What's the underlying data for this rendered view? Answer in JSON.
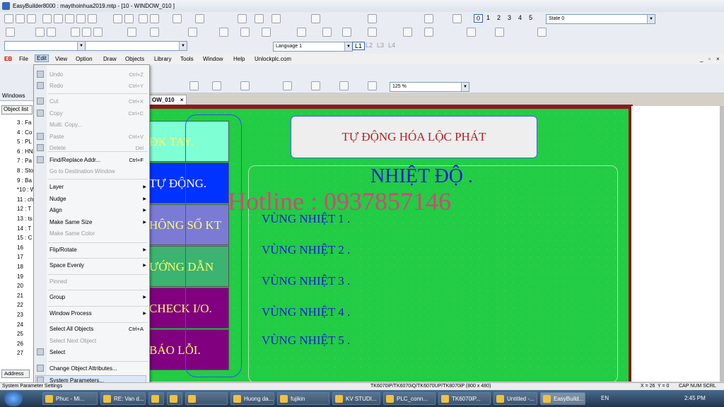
{
  "window": {
    "title": "EasyBuilder8000 : maythoinhua2019.mtp - [10 - WINDOW_010 ]"
  },
  "toolbar": {
    "level_buttons": [
      "0",
      "1",
      "2",
      "3",
      "4",
      "5"
    ],
    "state_combo": "State 0",
    "language_combo": "Language 1",
    "layer_buttons": [
      "L1",
      "L2",
      "L3",
      "L4"
    ],
    "zoom_combo": "125 %"
  },
  "menubar": {
    "logo": "EB",
    "items": [
      "File",
      "Edit",
      "View",
      "Option",
      "Draw",
      "Objects",
      "Library",
      "Tools",
      "Window",
      "Help",
      "Unlockplc.com"
    ]
  },
  "panel": {
    "header": "Windows",
    "tab": "Object list",
    "tree": [
      "3 : Fa",
      "4 : Co",
      "5 : PL",
      "6 : HN",
      "7 : Pa",
      "8 : Sto",
      "9 : Ba",
      "*10 : W",
      "11 : ch",
      "12 : T",
      "13 : ts",
      "14 : T",
      "15 : C",
      "16",
      "17",
      "18",
      "19",
      "20",
      "21",
      "22",
      "23",
      "24",
      "25",
      "26",
      "27"
    ],
    "address_tab": "Address"
  },
  "doc_tab": {
    "label": "OW_010"
  },
  "menu": {
    "items": [
      {
        "label": "Undo",
        "shortcut": "Ctrl+Z",
        "disabled": true
      },
      {
        "label": "Redo",
        "shortcut": "Ctrl+Y",
        "disabled": true
      },
      {
        "label": "Cut",
        "shortcut": "Ctrl+X",
        "disabled": true
      },
      {
        "label": "Copy",
        "shortcut": "Ctrl+C",
        "disabled": true
      },
      {
        "label": "Multi. Copy...",
        "shortcut": "",
        "disabled": true
      },
      {
        "label": "Paste",
        "shortcut": "Ctrl+V",
        "disabled": true
      },
      {
        "label": "Delete",
        "shortcut": "Del",
        "disabled": true
      },
      {
        "label": "Find/Replace Addr...",
        "shortcut": "Ctrl+F",
        "disabled": false
      },
      {
        "label": "Go to Destination Window",
        "shortcut": "",
        "disabled": true
      },
      {
        "label": "Layer",
        "shortcut": "",
        "disabled": false
      },
      {
        "label": "Nudge",
        "shortcut": "",
        "disabled": false
      },
      {
        "label": "Align",
        "shortcut": "",
        "disabled": false
      },
      {
        "label": "Make Same Size",
        "shortcut": "",
        "disabled": false
      },
      {
        "label": "Make Same Color",
        "shortcut": "",
        "disabled": true
      },
      {
        "label": "Flip/Rotate",
        "shortcut": "",
        "disabled": false
      },
      {
        "label": "Space Evenly",
        "shortcut": "",
        "disabled": false
      },
      {
        "label": "Pinned",
        "shortcut": "",
        "disabled": true
      },
      {
        "label": "Group",
        "shortcut": "",
        "disabled": false
      },
      {
        "label": "Window Process",
        "shortcut": "",
        "disabled": false
      },
      {
        "label": "Select All Objects",
        "shortcut": "Ctrl+A",
        "disabled": false
      },
      {
        "label": "Select Next Object",
        "shortcut": "",
        "disabled": true
      },
      {
        "label": "Select",
        "shortcut": "",
        "disabled": false
      },
      {
        "label": "Change Object Attributes...",
        "shortcut": "",
        "disabled": false
      },
      {
        "label": "System Parameters...",
        "shortcut": "",
        "disabled": false
      }
    ]
  },
  "canvas": {
    "side_buttons": [
      {
        "label": "ĐK TAY.",
        "bg": "#7fffd4",
        "fg": "#ffff66"
      },
      {
        "label": "TỰ ĐỘNG.",
        "bg": "#0033ff",
        "fg": "#ffffff"
      },
      {
        "label": "HÔNG SỐ KT",
        "bg": "#7b7bd6",
        "fg": "#ffff66"
      },
      {
        "label": "ƯỚNG DẪN",
        "bg": "#3cb371",
        "fg": "#ffff66"
      },
      {
        "label": "CHECK I/O.",
        "bg": "#800080",
        "fg": "#ffff66"
      },
      {
        "label": "BÁO LỖI.",
        "bg": "#800080",
        "fg": "#ffff66"
      }
    ],
    "company": "TỰ ĐỘNG HÓA LỘC PHÁT",
    "temp_title": "NHIỆT ĐỘ .",
    "hotline": "Hotline : 0937857146",
    "zones": [
      "VÙNG NHIỆT 1 .",
      "VÙNG NHIỆT 2 .",
      "VÙNG NHIỆT 3 .",
      "VÙNG NHIỆT 4 .",
      "VÙNG NHIỆT 5 ."
    ]
  },
  "statusbar": {
    "left": "System Parameter Settings",
    "model": "TK6070iP/TK6070iQ/TK6070UP/TK8070iP (800 x 480)",
    "x": "X = 26",
    "y": "Y = 0",
    "keys": "CAP  NUM  SCRL"
  },
  "taskbar": {
    "buttons": [
      "Phuc - Mi...",
      "RE: Van d...",
      "",
      "",
      "",
      "Huong da...",
      "fujikin",
      "KV STUDI...",
      "PLC_conn...",
      "TK6070iP...",
      "Untitled -...",
      "EasyBuild..."
    ],
    "lang": "EN",
    "time": "2:45 PM"
  },
  "colors": {
    "canvas_green": "#22cc44",
    "zone_blue": "#1a1adb",
    "hotline": "#d6457a",
    "company_red": "#b22222"
  }
}
